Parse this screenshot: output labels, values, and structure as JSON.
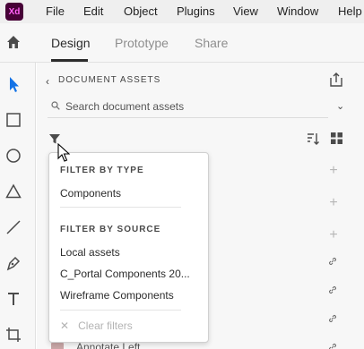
{
  "app": {
    "logo_text": "Xd"
  },
  "menu": [
    "File",
    "Edit",
    "Object",
    "Plugins",
    "View",
    "Window",
    "Help"
  ],
  "tabs": {
    "design": "Design",
    "prototype": "Prototype",
    "share": "Share"
  },
  "toolbar": [
    "select-icon",
    "rectangle-icon",
    "ellipse-icon",
    "triangle-icon",
    "line-icon",
    "pen-icon",
    "text-icon",
    "artboard-icon"
  ],
  "panel": {
    "title": "DOCUMENT ASSETS",
    "search_placeholder": "Search document assets"
  },
  "dropdown": {
    "filter_by_type_heading": "FILTER BY TYPE",
    "type_items": [
      "Components"
    ],
    "filter_by_source_heading": "FILTER BY SOURCE",
    "source_items": [
      "Local assets",
      "C_Portal Components 20...",
      "Wireframe Components"
    ],
    "clear_label": "Clear filters"
  },
  "partially_hidden_row": "Annotate Left",
  "colors": {
    "accent": "#470137",
    "logo_fg": "#ff61f6",
    "tool_active": "#1473e6"
  }
}
